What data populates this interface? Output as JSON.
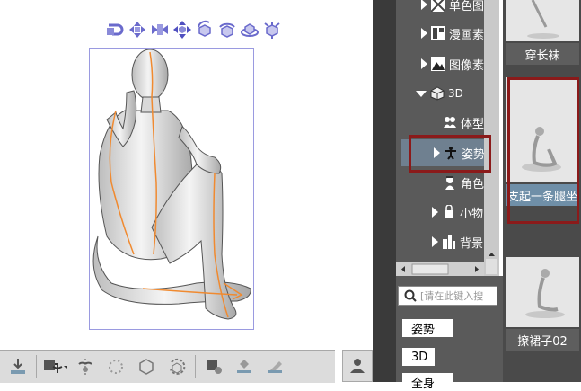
{
  "tree": {
    "items": [
      {
        "label": "单色图",
        "icon": "monochrome-pattern-icon",
        "expanded": false
      },
      {
        "label": "漫画素",
        "icon": "manga-material-icon",
        "expanded": false
      },
      {
        "label": "图像素",
        "icon": "image-material-icon",
        "expanded": false
      },
      {
        "label": "3D",
        "icon": "3d-cube-icon",
        "expanded": true
      },
      {
        "label": "体型",
        "icon": "body-type-icon"
      },
      {
        "label": "姿势",
        "icon": "pose-icon",
        "expanded": false,
        "selected": true
      },
      {
        "label": "角色",
        "icon": "character-icon"
      },
      {
        "label": "小物",
        "icon": "small-object-icon",
        "expanded": false
      },
      {
        "label": "背景",
        "icon": "background-icon",
        "expanded": false
      }
    ]
  },
  "search": {
    "placeholder": "[请在此键入搜"
  },
  "tags": [
    "姿势",
    "3D",
    "全身"
  ],
  "thumbnails": [
    {
      "label": "穿长袜"
    },
    {
      "label": "支起一条腿坐"
    },
    {
      "label": "撩裙子02"
    }
  ],
  "colors": {
    "highlight": "#8b1a1a",
    "gizmo": "#6a6acc",
    "bone": "#f08a30"
  }
}
